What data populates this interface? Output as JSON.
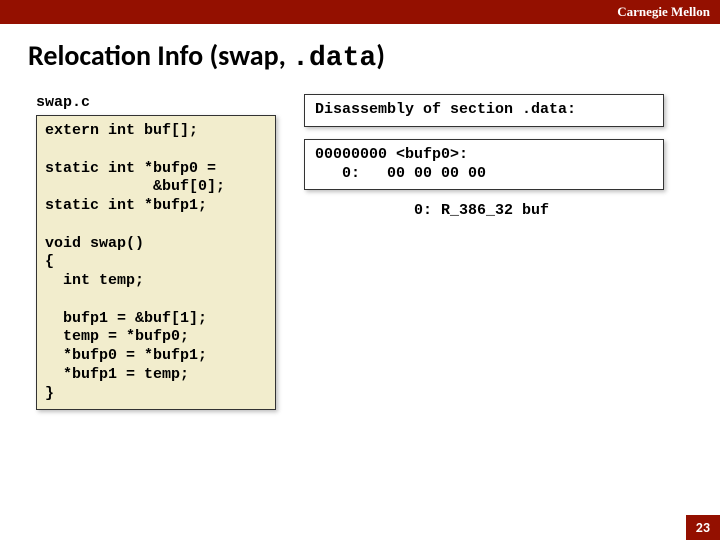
{
  "header": {
    "brand": "Carnegie Mellon"
  },
  "title": {
    "prefix": "Relocation Info (swap, ",
    "mono": ".data",
    "suffix": ")"
  },
  "left": {
    "filename": "swap.c",
    "code": "extern int buf[];\n\nstatic int *bufp0 =\n            &buf[0];\nstatic int *bufp1;\n\nvoid swap()\n{\n  int temp;\n\n  bufp1 = &buf[1];\n  temp = *bufp0;\n  *bufp0 = *bufp1;\n  *bufp1 = temp;\n}"
  },
  "right": {
    "disassembly_header": "Disassembly of section .data:",
    "disassembly_body": "00000000 <bufp0>:\n   0:   00 00 00 00",
    "relocation": "0: R_386_32 buf"
  },
  "page_number": "23"
}
